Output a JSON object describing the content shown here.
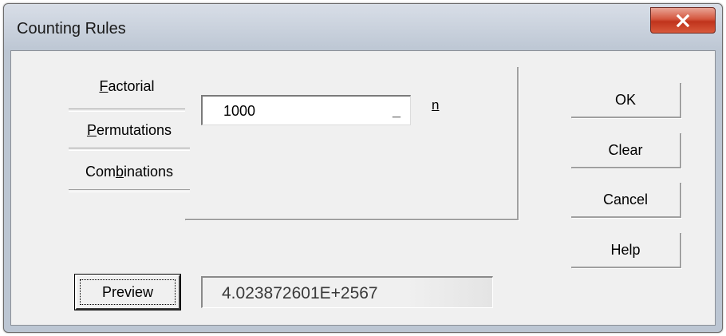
{
  "window": {
    "title": "Counting Rules",
    "close_glyph": "X"
  },
  "modes": [
    {
      "pre": "",
      "key": "F",
      "post": "actorial"
    },
    {
      "pre": "",
      "key": "P",
      "post": "ermutations"
    },
    {
      "pre": "Com",
      "key": "b",
      "post": "inations"
    }
  ],
  "input": {
    "value": "1000",
    "dash": "_",
    "label": "n"
  },
  "buttons": {
    "ok": "OK",
    "clear": "Clear",
    "cancel": "Cancel",
    "help": "Help",
    "preview": "Preview"
  },
  "result": {
    "value": "4.023872601E+2567"
  }
}
